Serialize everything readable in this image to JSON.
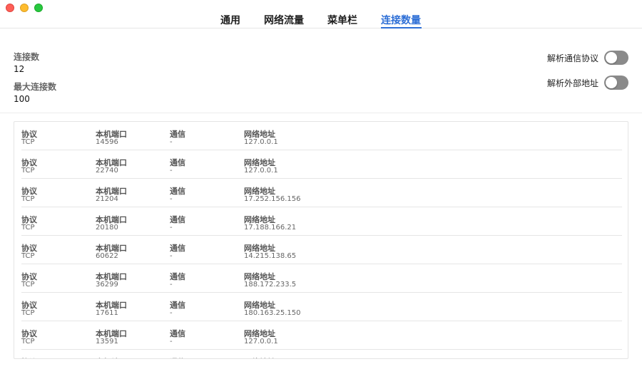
{
  "window": {
    "tabs": [
      {
        "label": "通用",
        "active": false
      },
      {
        "label": "网络流量",
        "active": false
      },
      {
        "label": "菜单栏",
        "active": false
      },
      {
        "label": "连接数量",
        "active": true
      }
    ]
  },
  "summary": {
    "connections_label": "连接数",
    "connections_value": "12",
    "max_connections_label": "最大连接数",
    "max_connections_value": "100"
  },
  "toggles": [
    {
      "label": "解析通信协议",
      "on": false
    },
    {
      "label": "解析外部地址",
      "on": false
    }
  ],
  "columns": [
    "协议",
    "本机端口",
    "通信",
    "网络地址"
  ],
  "connections": [
    {
      "protocol": "TCP",
      "port": "14596",
      "comm": "-",
      "address": "127.0.0.1"
    },
    {
      "protocol": "TCP",
      "port": "22740",
      "comm": "-",
      "address": "127.0.0.1"
    },
    {
      "protocol": "TCP",
      "port": "21204",
      "comm": "-",
      "address": "17.252.156.156"
    },
    {
      "protocol": "TCP",
      "port": "20180",
      "comm": "-",
      "address": "17.188.166.21"
    },
    {
      "protocol": "TCP",
      "port": "60622",
      "comm": "-",
      "address": "14.215.138.65"
    },
    {
      "protocol": "TCP",
      "port": "36299",
      "comm": "-",
      "address": "188.172.233.5"
    },
    {
      "protocol": "TCP",
      "port": "17611",
      "comm": "-",
      "address": "180.163.25.150"
    },
    {
      "protocol": "TCP",
      "port": "13591",
      "comm": "-",
      "address": "127.0.0.1"
    },
    {
      "protocol": "",
      "port": "",
      "comm": "",
      "address": ""
    }
  ],
  "colors": {
    "accent": "#2e6fd6",
    "toggle_off": "#8a8a8a"
  }
}
